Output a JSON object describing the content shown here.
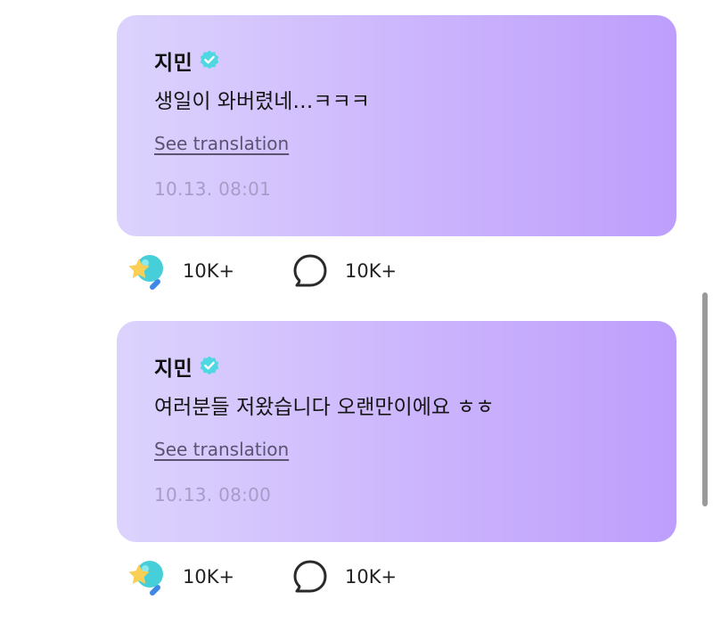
{
  "posts": [
    {
      "author": "지민",
      "verified": true,
      "text": "생일이 와버렸네…ㅋㅋㅋ",
      "translate_label": "See translation",
      "timestamp": "10.13. 08:01",
      "like_count": "10K+",
      "comment_count": "10K+"
    },
    {
      "author": "지민",
      "verified": true,
      "text": "여러분들 저왔습니다 오랜만이에요 ㅎㅎ",
      "translate_label": "See translation",
      "timestamp": "10.13. 08:00",
      "like_count": "10K+",
      "comment_count": "10K+"
    }
  ],
  "icons": {
    "verified": "verified-badge-icon",
    "like": "star-heart-icon",
    "comment": "speech-bubble-icon"
  },
  "colors": {
    "bubble_gradient_start": "#dcd3fd",
    "bubble_gradient_end": "#be9efc",
    "verified_badge": "#4fd8e2",
    "timestamp": "#a99bc8",
    "translate_link": "#5b5372"
  }
}
